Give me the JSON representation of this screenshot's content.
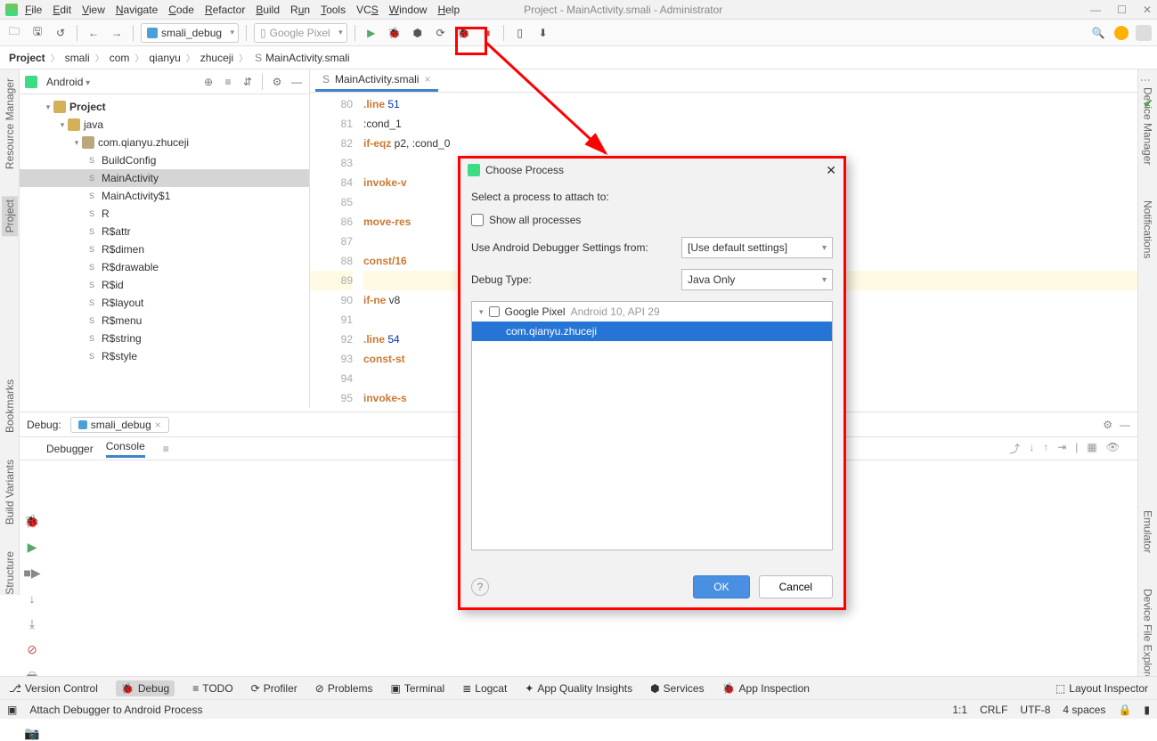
{
  "window_title": "Project - MainActivity.smali - Administrator",
  "menus": [
    "File",
    "Edit",
    "View",
    "Navigate",
    "Code",
    "Refactor",
    "Build",
    "Run",
    "Tools",
    "VCS",
    "Window",
    "Help"
  ],
  "toolbar": {
    "config": "smali_debug",
    "device": "Google Pixel"
  },
  "breadcrumbs": [
    "Project",
    "smali",
    "com",
    "qianyu",
    "zhuceji",
    "MainActivity.smali"
  ],
  "project_panel": {
    "view": "Android",
    "root": "Project",
    "java": "java",
    "pkg": "com.qianyu.zhuceji",
    "classes": [
      "BuildConfig",
      "MainActivity",
      "MainActivity$1",
      "R",
      "R$attr",
      "R$dimen",
      "R$drawable",
      "R$id",
      "R$layout",
      "R$menu",
      "R$string",
      "R$style"
    ]
  },
  "tab_name": "MainActivity.smali",
  "lines": [
    "80",
    "81",
    "82",
    "83",
    "84",
    "85",
    "86",
    "87",
    "88",
    "89",
    "90",
    "91",
    "92",
    "93",
    "94",
    "95"
  ],
  "code_html": [
    "<span class='kw'>.line</span> <span class='num'>51</span>",
    ":cond_1",
    "<span class='kw'>if-eqz</span> p2, :cond_0",
    "",
    "<span class='kw'>invoke-v</span>",
    "",
    "<span class='kw'>move-res</span>",
    "",
    "<span class='kw'>const/16</span>",
    "",
    "<span class='kw'>if-ne</span> v8",
    "",
    "<span class='kw'>.line</span> <span class='num'>54</span>",
    "<span class='kw'>const-st</span>",
    "",
    "<span class='kw'>invoke-s</span>                                                         Ljava/lang/String;)Ljava/security/Message"
  ],
  "hl_index": 9,
  "debug": {
    "title": "Debug:",
    "config": "smali_debug",
    "tab1": "Debugger",
    "tab2": "Console"
  },
  "dialog": {
    "title": "Choose Process",
    "subtitle": "Select a process to attach to:",
    "show_all": "Show all processes",
    "settings_label": "Use Android Debugger Settings from:",
    "settings_value": "[Use default settings]",
    "type_label": "Debug Type:",
    "type_value": "Java Only",
    "device": "Google Pixel",
    "device_meta": "Android 10, API 29",
    "process": "com.qianyu.zhuceji",
    "ok": "OK",
    "cancel": "Cancel"
  },
  "bottom_items": [
    "Version Control",
    "Debug",
    "TODO",
    "Profiler",
    "Problems",
    "Terminal",
    "Logcat",
    "App Quality Insights",
    "Services",
    "App Inspection"
  ],
  "bottom_right": "Layout Inspector",
  "status_left": "Attach Debugger to Android Process",
  "status_right": [
    "1:1",
    "CRLF",
    "UTF-8",
    "4 spaces"
  ],
  "left_tools": [
    "Resource Manager",
    "Project"
  ],
  "left_tools2": [
    "Bookmarks",
    "Build Variants",
    "Structure"
  ],
  "right_tools": [
    "Device Manager",
    "Notifications",
    "Emulator",
    "Device File Explorer"
  ]
}
